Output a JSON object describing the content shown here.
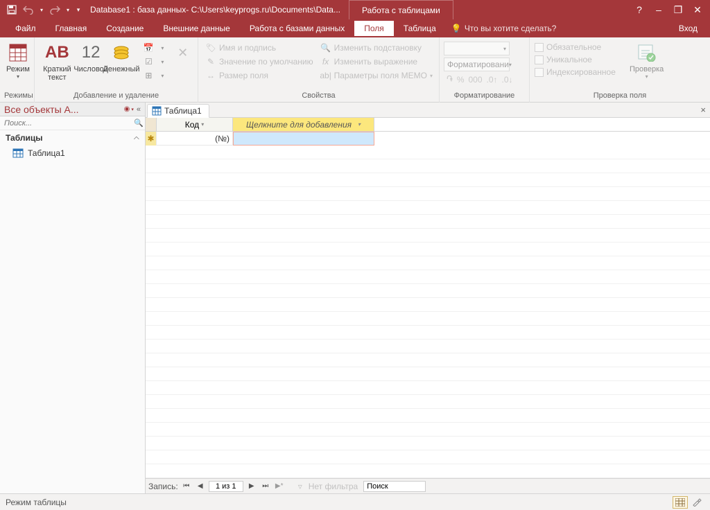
{
  "title": "Database1 : база данных- C:\\Users\\keyprogs.ru\\Documents\\Data...",
  "context_tab": "Работа с таблицами",
  "win": {
    "help": "?",
    "min": "–",
    "restore": "❐",
    "close": "✕"
  },
  "menu": {
    "file": "Файл",
    "home": "Главная",
    "create": "Создание",
    "external": "Внешние данные",
    "dbtools": "Работа с базами данных",
    "fields": "Поля",
    "table": "Таблица",
    "tellme": "Что вы хотите сделать?",
    "login": "Вход"
  },
  "ribbon": {
    "modes": {
      "label": "Режим",
      "group": "Режимы"
    },
    "add_delete": {
      "short": "Краткий текст",
      "num": "Числовой",
      "money": "Денежный",
      "group": "Добавление и удаление"
    },
    "props": {
      "name": "Имя и подпись",
      "default": "Значение по умолчанию",
      "size": "Размер поля",
      "lookup": "Изменить подстановку",
      "expr": "Изменить выражение",
      "memo": "Параметры поля MEMO",
      "group": "Свойства"
    },
    "format": {
      "box": "Форматировани",
      "group": "Форматирование"
    },
    "validate": {
      "required": "Обязательное",
      "unique": "Уникальное",
      "indexed": "Индексированное",
      "btn": "Проверка",
      "group": "Проверка поля"
    }
  },
  "nav": {
    "title": "Все объекты A...",
    "search": "Поиск...",
    "group": "Таблицы",
    "obj": "Таблица1"
  },
  "doc": {
    "tab": "Таблица1"
  },
  "grid": {
    "col_id": "Код",
    "col_add": "Щелкните для добавления",
    "new_id": "(№)"
  },
  "recnav": {
    "label": "Запись:",
    "pos": "1 из 1",
    "nofilter": "Нет фильтра",
    "search": "Поиск"
  },
  "status": {
    "mode": "Режим таблицы"
  }
}
